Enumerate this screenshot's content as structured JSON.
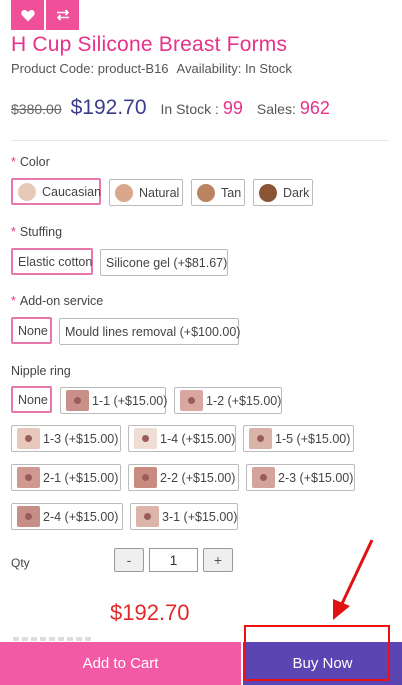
{
  "product": {
    "title": "H Cup Silicone Breast Forms",
    "code_label": "Product Code: product-B16",
    "availability_label": "Availability: In Stock",
    "old_price": "$380.00",
    "price": "$192.70",
    "stock_label": "In Stock :",
    "stock_value": "99",
    "sales_label": "Sales:",
    "sales_value": "962"
  },
  "options": {
    "color": {
      "label": "Color",
      "choices": [
        {
          "label": "Caucasian",
          "color": "#e6c9b8",
          "selected": true
        },
        {
          "label": "Natural",
          "color": "#d9a88a",
          "selected": false
        },
        {
          "label": "Tan",
          "color": "#b98560",
          "selected": false
        },
        {
          "label": "Dark",
          "color": "#8a5535",
          "selected": false
        }
      ]
    },
    "stuffing": {
      "label": "Stuffing",
      "choices": [
        {
          "label": "Elastic cotton",
          "selected": true
        },
        {
          "label": "Silicone gel (+$81.67)",
          "selected": false
        }
      ]
    },
    "addon": {
      "label": "Add-on service",
      "choices": [
        {
          "label": "None",
          "selected": true
        },
        {
          "label": "Mould lines removal (+$100.00)",
          "selected": false
        }
      ]
    },
    "nipple_ring": {
      "label": "Nipple ring",
      "choices": [
        {
          "label": "None",
          "selected": true
        },
        {
          "label": "1-1 (+$15.00)"
        },
        {
          "label": "1-2 (+$15.00)"
        },
        {
          "label": "1-3 (+$15.00)"
        },
        {
          "label": "1-4 (+$15.00)"
        },
        {
          "label": "1-5 (+$15.00)"
        },
        {
          "label": "2-1 (+$15.00)"
        },
        {
          "label": "2-2 (+$15.00)"
        },
        {
          "label": "2-3 (+$15.00)"
        },
        {
          "label": "2-4 (+$15.00)"
        },
        {
          "label": "3-1 (+$15.00)"
        }
      ]
    }
  },
  "qty": {
    "label": "Qty",
    "minus": "-",
    "plus": "+",
    "value": "1"
  },
  "total_price": "$192.70",
  "actions": {
    "add_to_cart": "Add to Cart",
    "buy_now": "Buy Now"
  },
  "colors": {
    "brand_pink": "#e6328a",
    "button_pink": "#f35aa5",
    "buy_purple": "#5b45b3",
    "annotation_red": "#e11111"
  },
  "icons": [
    "heart-icon",
    "compare-arrows-icon"
  ]
}
